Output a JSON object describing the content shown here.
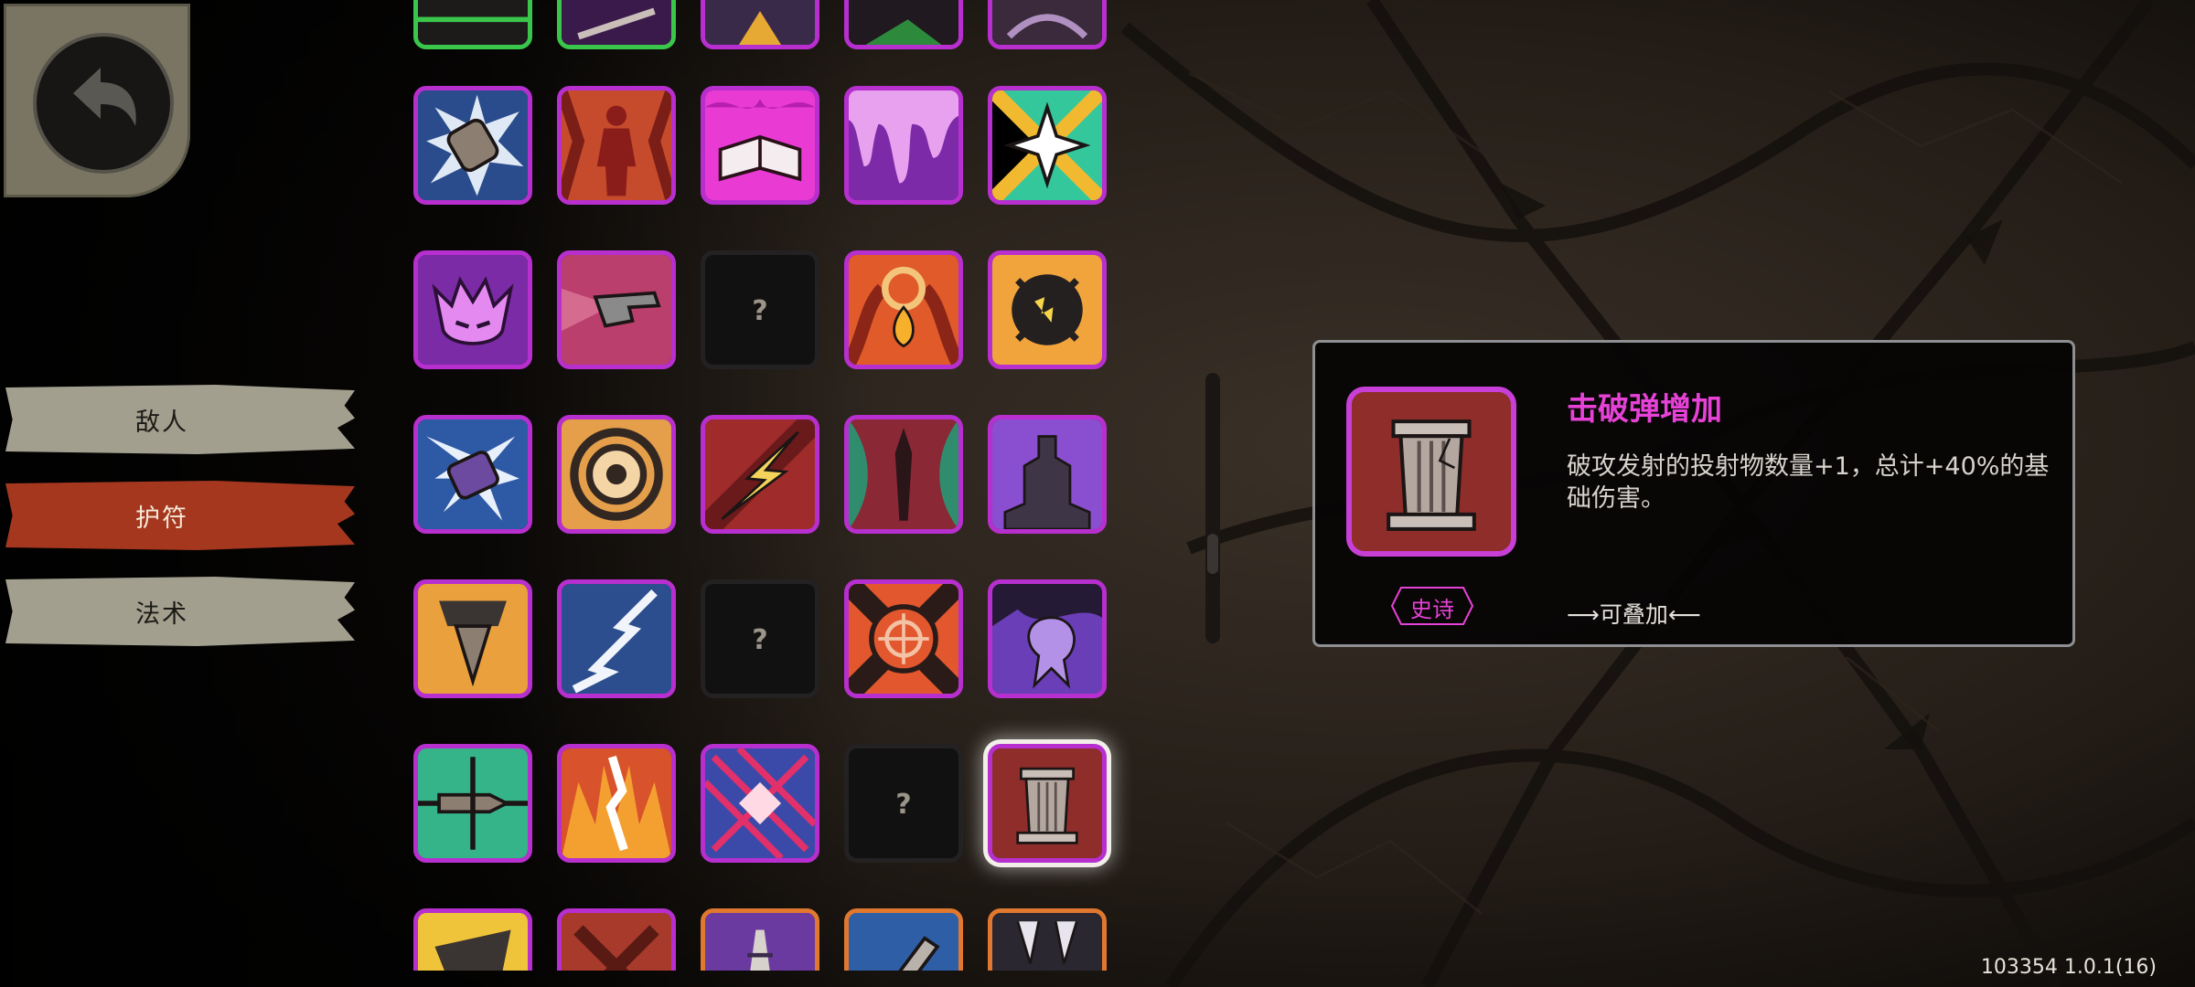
{
  "nav": {
    "enemies": "敌人",
    "charms": "护符",
    "spells": "法术"
  },
  "grid": {
    "unknown_mark": "?",
    "slots": [
      {
        "icon": "partial-rune-icon",
        "state": "green"
      },
      {
        "icon": "partial-blade-icon",
        "state": "green"
      },
      {
        "icon": "partial-flame-icon",
        "state": "epic"
      },
      {
        "icon": "partial-leaf-icon",
        "state": "epic"
      },
      {
        "icon": "partial-claw-icon",
        "state": "epic"
      },
      {
        "icon": "shattered-stone-icon",
        "state": "epic"
      },
      {
        "icon": "blood-figure-icon",
        "state": "epic"
      },
      {
        "icon": "glowing-book-icon",
        "state": "epic"
      },
      {
        "icon": "dripping-void-icon",
        "state": "epic"
      },
      {
        "icon": "star-burst-icon",
        "state": "epic"
      },
      {
        "icon": "demon-crown-icon",
        "state": "epic"
      },
      {
        "icon": "pointing-hand-icon",
        "state": "epic"
      },
      {
        "icon": "unknown-icon",
        "state": "empty"
      },
      {
        "icon": "fire-drop-icon",
        "state": "epic"
      },
      {
        "icon": "cracked-orb-icon",
        "state": "epic"
      },
      {
        "icon": "crystal-charm-icon",
        "state": "epic"
      },
      {
        "icon": "target-eye-icon",
        "state": "epic"
      },
      {
        "icon": "lightning-bolt-icon",
        "state": "epic"
      },
      {
        "icon": "thorn-spear-icon",
        "state": "epic"
      },
      {
        "icon": "dark-tower-icon",
        "state": "epic"
      },
      {
        "icon": "drill-icon",
        "state": "epic"
      },
      {
        "icon": "chain-lightning-icon",
        "state": "epic"
      },
      {
        "icon": "unknown-icon",
        "state": "empty"
      },
      {
        "icon": "crosshair-icon",
        "state": "epic"
      },
      {
        "icon": "ghost-splash-icon",
        "state": "epic"
      },
      {
        "icon": "piercing-bullet-icon",
        "state": "epic"
      },
      {
        "icon": "fire-crack-icon",
        "state": "epic"
      },
      {
        "icon": "crossed-blades-icon",
        "state": "epic"
      },
      {
        "icon": "unknown-icon",
        "state": "empty"
      },
      {
        "icon": "broken-pillar-icon",
        "state": "selected"
      },
      {
        "icon": "partial-gold-icon",
        "state": "epic"
      },
      {
        "icon": "partial-cross-icon",
        "state": "epic"
      },
      {
        "icon": "partial-rail-icon",
        "state": "orange"
      },
      {
        "icon": "partial-bottle-icon",
        "state": "orange"
      },
      {
        "icon": "partial-fangs-icon",
        "state": "orange"
      }
    ]
  },
  "tooltip": {
    "title": "击破弹增加",
    "description": "破攻发射的投射物数量+1，总计+40%的基础伤害。",
    "rarity": "史诗",
    "stackable": "⟶可叠加⟵",
    "icon": "broken-pillar-icon"
  },
  "version": "103354 1.0.1(16)",
  "colors": {
    "epic_border": "#b72fce",
    "accent_title": "#e742d7",
    "nav_active": "#a5371f",
    "nav_normal": "#a29f8e"
  }
}
